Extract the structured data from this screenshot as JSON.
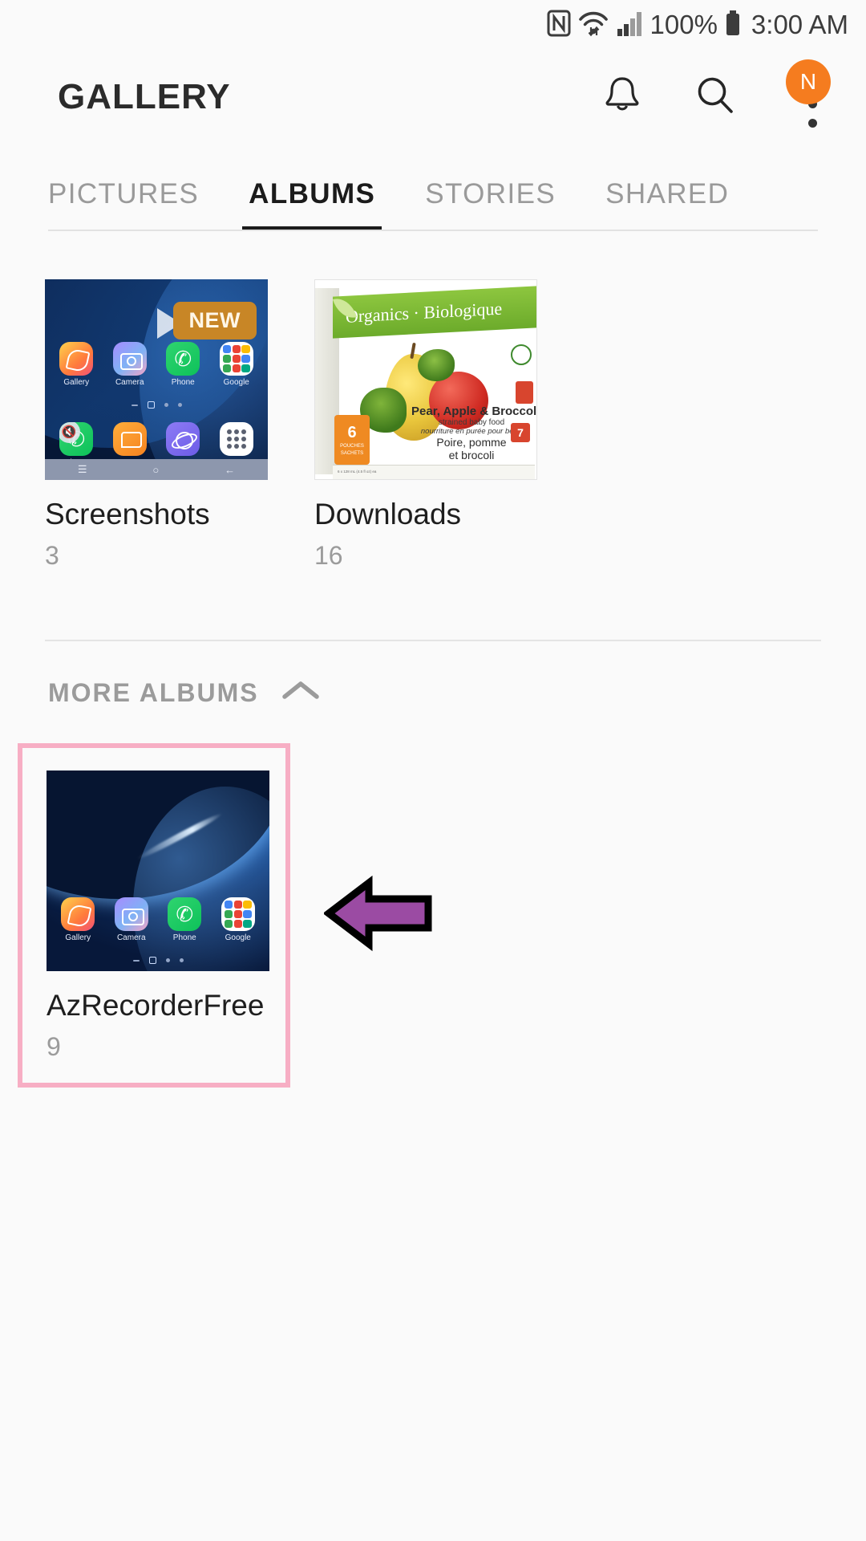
{
  "status_bar": {
    "nfc_icon": "nfc-icon",
    "wifi_icon": "wifi-icon",
    "signal_icon": "signal-bars-icon",
    "battery_percent": "100%",
    "battery_icon": "battery-full-icon",
    "time": "3:00 AM"
  },
  "app_bar": {
    "title": "GALLERY",
    "notifications_icon": "bell-icon",
    "search_icon": "search-icon",
    "overflow_icon": "more-options-icon",
    "avatar_initial": "N",
    "avatar_color": "#f57c1f"
  },
  "tabs": [
    {
      "label": "PICTURES",
      "active": false
    },
    {
      "label": "ALBUMS",
      "active": true
    },
    {
      "label": "STORIES",
      "active": false
    },
    {
      "label": "SHARED",
      "active": false
    }
  ],
  "albums": [
    {
      "name": "Screenshots",
      "count": "3",
      "badge": "NEW"
    },
    {
      "name": "Downloads",
      "count": "16"
    }
  ],
  "more_albums": {
    "label": "MORE ALBUMS",
    "collapse_icon": "chevron-up-icon",
    "items": [
      {
        "name": "AzRecorderFree",
        "count": "9",
        "highlighted": true
      }
    ]
  },
  "annotation": {
    "arrow": "left-arrow-annotation",
    "arrow_fill": "#9b4ba3",
    "arrow_stroke": "#000000",
    "highlight_color": "#f7aec4"
  },
  "thumbnail_screenshots": {
    "apps_row1": [
      "Gallery",
      "Camera",
      "Phone",
      "Google"
    ],
    "apps_row2": [
      "Phone",
      "Messages",
      "Internet",
      "Apps"
    ],
    "play_icon": "play-triangle-icon"
  },
  "thumbnail_downloads": {
    "brand": "Organics · Biologique",
    "product_line1": "Pear, Apple & Broccoli",
    "product_line2": "strained baby food",
    "product_line3": "nourriture en purée pour bébé",
    "product_line4": "Poire, pomme",
    "product_line5": "et brocoli",
    "pouch_count": "6",
    "pouch_label_en": "POUCHES",
    "pouch_label_fr": "SACHETS",
    "size_text": "6 x 128 mL (4.5 fl oz) ea",
    "age_badge": "7"
  },
  "thumbnail_azrecorder": {
    "apps_row1": [
      "Gallery",
      "Camera",
      "Phone",
      "Google"
    ]
  }
}
